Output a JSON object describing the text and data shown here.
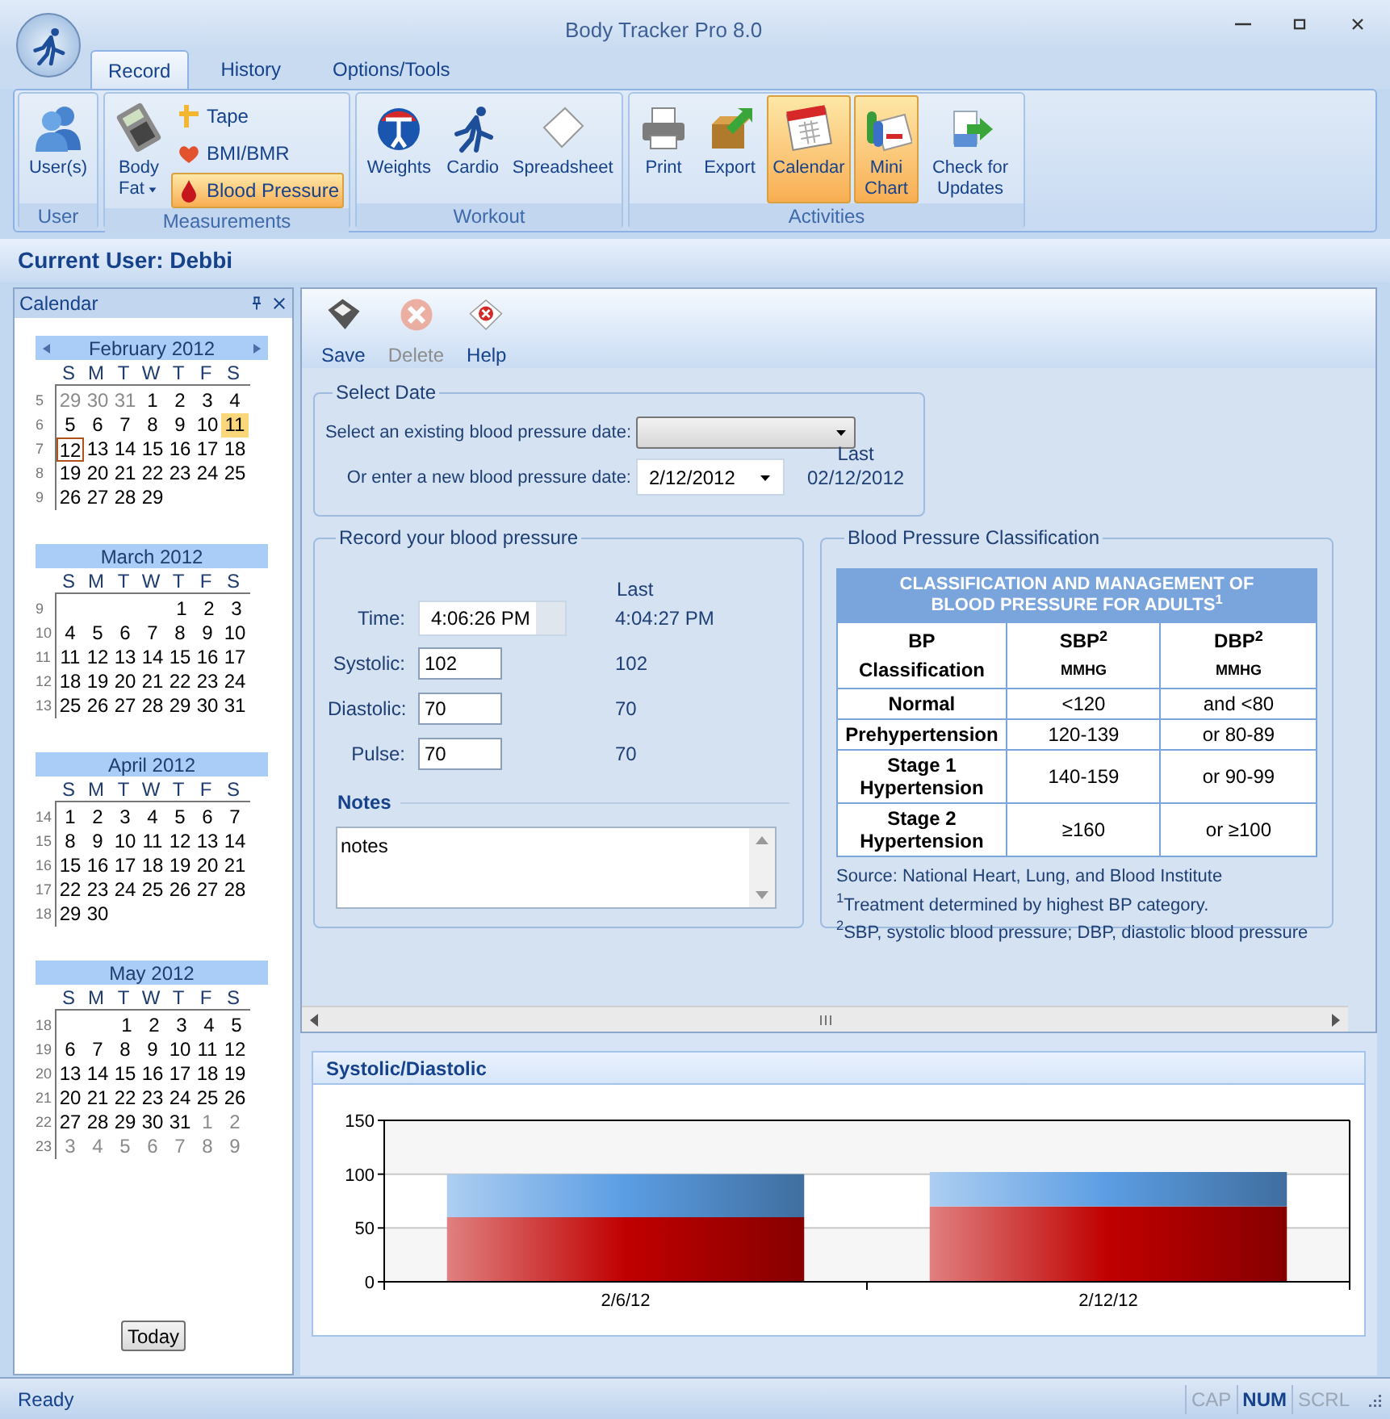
{
  "window": {
    "title": "Body Tracker Pro 8.0"
  },
  "ribbon_tabs": [
    {
      "label": "Record",
      "selected": true
    },
    {
      "label": "History",
      "selected": false
    },
    {
      "label": "Options/Tools",
      "selected": false
    }
  ],
  "ribbon_groups": [
    {
      "label": "User",
      "items": [
        {
          "label": "User(s)",
          "kind": "large",
          "selected": false
        }
      ]
    },
    {
      "label": "Measurements",
      "items": [
        {
          "label": "Body Fat",
          "kind": "dropdown",
          "selected": false
        },
        {
          "label": "Tape",
          "kind": "small",
          "selected": false
        },
        {
          "label": "BMI/BMR",
          "kind": "small",
          "selected": false
        },
        {
          "label": "Blood Pressure",
          "kind": "small",
          "selected": true
        }
      ]
    },
    {
      "label": "Workout",
      "items": [
        {
          "label": "Weights",
          "kind": "large",
          "selected": false
        },
        {
          "label": "Cardio",
          "kind": "large",
          "selected": false
        },
        {
          "label": "Spreadsheet",
          "kind": "large",
          "selected": false
        }
      ]
    },
    {
      "label": "Activities",
      "items": [
        {
          "label": "Print",
          "kind": "large",
          "selected": false
        },
        {
          "label": "Export",
          "kind": "large",
          "selected": false
        },
        {
          "label": "Calendar",
          "kind": "large",
          "selected": true
        },
        {
          "label": "Mini Chart",
          "kind": "large",
          "selected": true
        },
        {
          "label": "Check for Updates",
          "kind": "large",
          "selected": false
        }
      ]
    }
  ],
  "current_user": "Current User: Debbi",
  "calendar": {
    "title": "Calendar",
    "today_button": "Today",
    "months": [
      {
        "title": "February 2012",
        "nav_arrows": true,
        "weekdays": [
          "S",
          "M",
          "T",
          "W",
          "T",
          "F",
          "S"
        ],
        "weeks": [
          {
            "week": "5",
            "days": [
              {
                "day": "29",
                "other_month": true,
                "selected": false,
                "today": false
              },
              {
                "day": "30",
                "other_month": true,
                "selected": false,
                "today": false
              },
              {
                "day": "31",
                "other_month": true,
                "selected": false,
                "today": false
              },
              {
                "day": "1",
                "other_month": false,
                "selected": false,
                "today": false
              },
              {
                "day": "2",
                "other_month": false,
                "selected": false,
                "today": false
              },
              {
                "day": "3",
                "other_month": false,
                "selected": false,
                "today": false
              },
              {
                "day": "4",
                "other_month": false,
                "selected": false,
                "today": false
              }
            ]
          },
          {
            "week": "6",
            "days": [
              {
                "day": "5",
                "other_month": false,
                "selected": false,
                "today": false
              },
              {
                "day": "6",
                "other_month": false,
                "selected": false,
                "today": false
              },
              {
                "day": "7",
                "other_month": false,
                "selected": false,
                "today": false
              },
              {
                "day": "8",
                "other_month": false,
                "selected": false,
                "today": false
              },
              {
                "day": "9",
                "other_month": false,
                "selected": false,
                "today": false
              },
              {
                "day": "10",
                "other_month": false,
                "selected": false,
                "today": false
              },
              {
                "day": "11",
                "other_month": false,
                "selected": true,
                "today": false
              }
            ]
          },
          {
            "week": "7",
            "days": [
              {
                "day": "12",
                "other_month": false,
                "selected": false,
                "today": true
              },
              {
                "day": "13",
                "other_month": false,
                "selected": false,
                "today": false
              },
              {
                "day": "14",
                "other_month": false,
                "selected": false,
                "today": false
              },
              {
                "day": "15",
                "other_month": false,
                "selected": false,
                "today": false
              },
              {
                "day": "16",
                "other_month": false,
                "selected": false,
                "today": false
              },
              {
                "day": "17",
                "other_month": false,
                "selected": false,
                "today": false
              },
              {
                "day": "18",
                "other_month": false,
                "selected": false,
                "today": false
              }
            ]
          },
          {
            "week": "8",
            "days": [
              {
                "day": "19",
                "other_month": false,
                "selected": false,
                "today": false
              },
              {
                "day": "20",
                "other_month": false,
                "selected": false,
                "today": false
              },
              {
                "day": "21",
                "other_month": false,
                "selected": false,
                "today": false
              },
              {
                "day": "22",
                "other_month": false,
                "selected": false,
                "today": false
              },
              {
                "day": "23",
                "other_month": false,
                "selected": false,
                "today": false
              },
              {
                "day": "24",
                "other_month": false,
                "selected": false,
                "today": false
              },
              {
                "day": "25",
                "other_month": false,
                "selected": false,
                "today": false
              }
            ]
          },
          {
            "week": "9",
            "days": [
              {
                "day": "26",
                "other_month": false,
                "selected": false,
                "today": false
              },
              {
                "day": "27",
                "other_month": false,
                "selected": false,
                "today": false
              },
              {
                "day": "28",
                "other_month": false,
                "selected": false,
                "today": false
              },
              {
                "day": "29",
                "other_month": false,
                "selected": false,
                "today": false
              }
            ]
          }
        ]
      },
      {
        "title": "March 2012",
        "nav_arrows": false,
        "weekdays": [
          "S",
          "M",
          "T",
          "W",
          "T",
          "F",
          "S"
        ],
        "weeks": [
          {
            "week": "9",
            "align_end": true,
            "days": [
              {
                "day": "1",
                "other_month": false,
                "selected": false,
                "today": false
              },
              {
                "day": "2",
                "other_month": false,
                "selected": false,
                "today": false
              },
              {
                "day": "3",
                "other_month": false,
                "selected": false,
                "today": false
              }
            ]
          },
          {
            "week": "10",
            "days": [
              {
                "day": "4",
                "other_month": false,
                "selected": false,
                "today": false
              },
              {
                "day": "5",
                "other_month": false,
                "selected": false,
                "today": false
              },
              {
                "day": "6",
                "other_month": false,
                "selected": false,
                "today": false
              },
              {
                "day": "7",
                "other_month": false,
                "selected": false,
                "today": false
              },
              {
                "day": "8",
                "other_month": false,
                "selected": false,
                "today": false
              },
              {
                "day": "9",
                "other_month": false,
                "selected": false,
                "today": false
              },
              {
                "day": "10",
                "other_month": false,
                "selected": false,
                "today": false
              }
            ]
          },
          {
            "week": "11",
            "days": [
              {
                "day": "11",
                "other_month": false,
                "selected": false,
                "today": false
              },
              {
                "day": "12",
                "other_month": false,
                "selected": false,
                "today": false
              },
              {
                "day": "13",
                "other_month": false,
                "selected": false,
                "today": false
              },
              {
                "day": "14",
                "other_month": false,
                "selected": false,
                "today": false
              },
              {
                "day": "15",
                "other_month": false,
                "selected": false,
                "today": false
              },
              {
                "day": "16",
                "other_month": false,
                "selected": false,
                "today": false
              },
              {
                "day": "17",
                "other_month": false,
                "selected": false,
                "today": false
              }
            ]
          },
          {
            "week": "12",
            "days": [
              {
                "day": "18",
                "other_month": false,
                "selected": false,
                "today": false
              },
              {
                "day": "19",
                "other_month": false,
                "selected": false,
                "today": false
              },
              {
                "day": "20",
                "other_month": false,
                "selected": false,
                "today": false
              },
              {
                "day": "21",
                "other_month": false,
                "selected": false,
                "today": false
              },
              {
                "day": "22",
                "other_month": false,
                "selected": false,
                "today": false
              },
              {
                "day": "23",
                "other_month": false,
                "selected": false,
                "today": false
              },
              {
                "day": "24",
                "other_month": false,
                "selected": false,
                "today": false
              }
            ]
          },
          {
            "week": "13",
            "days": [
              {
                "day": "25",
                "other_month": false,
                "selected": false,
                "today": false
              },
              {
                "day": "26",
                "other_month": false,
                "selected": false,
                "today": false
              },
              {
                "day": "27",
                "other_month": false,
                "selected": false,
                "today": false
              },
              {
                "day": "28",
                "other_month": false,
                "selected": false,
                "today": false
              },
              {
                "day": "29",
                "other_month": false,
                "selected": false,
                "today": false
              },
              {
                "day": "30",
                "other_month": false,
                "selected": false,
                "today": false
              },
              {
                "day": "31",
                "other_month": false,
                "selected": false,
                "today": false
              }
            ]
          }
        ]
      },
      {
        "title": "April 2012",
        "nav_arrows": false,
        "weekdays": [
          "S",
          "M",
          "T",
          "W",
          "T",
          "F",
          "S"
        ],
        "weeks": [
          {
            "week": "14",
            "days": [
              {
                "day": "1",
                "other_month": false,
                "selected": false,
                "today": false
              },
              {
                "day": "2",
                "other_month": false,
                "selected": false,
                "today": false
              },
              {
                "day": "3",
                "other_month": false,
                "selected": false,
                "today": false
              },
              {
                "day": "4",
                "other_month": false,
                "selected": false,
                "today": false
              },
              {
                "day": "5",
                "other_month": false,
                "selected": false,
                "today": false
              },
              {
                "day": "6",
                "other_month": false,
                "selected": false,
                "today": false
              },
              {
                "day": "7",
                "other_month": false,
                "selected": false,
                "today": false
              }
            ]
          },
          {
            "week": "15",
            "days": [
              {
                "day": "8",
                "other_month": false,
                "selected": false,
                "today": false
              },
              {
                "day": "9",
                "other_month": false,
                "selected": false,
                "today": false
              },
              {
                "day": "10",
                "other_month": false,
                "selected": false,
                "today": false
              },
              {
                "day": "11",
                "other_month": false,
                "selected": false,
                "today": false
              },
              {
                "day": "12",
                "other_month": false,
                "selected": false,
                "today": false
              },
              {
                "day": "13",
                "other_month": false,
                "selected": false,
                "today": false
              },
              {
                "day": "14",
                "other_month": false,
                "selected": false,
                "today": false
              }
            ]
          },
          {
            "week": "16",
            "days": [
              {
                "day": "15",
                "other_month": false,
                "selected": false,
                "today": false
              },
              {
                "day": "16",
                "other_month": false,
                "selected": false,
                "today": false
              },
              {
                "day": "17",
                "other_month": false,
                "selected": false,
                "today": false
              },
              {
                "day": "18",
                "other_month": false,
                "selected": false,
                "today": false
              },
              {
                "day": "19",
                "other_month": false,
                "selected": false,
                "today": false
              },
              {
                "day": "20",
                "other_month": false,
                "selected": false,
                "today": false
              },
              {
                "day": "21",
                "other_month": false,
                "selected": false,
                "today": false
              }
            ]
          },
          {
            "week": "17",
            "days": [
              {
                "day": "22",
                "other_month": false,
                "selected": false,
                "today": false
              },
              {
                "day": "23",
                "other_month": false,
                "selected": false,
                "today": false
              },
              {
                "day": "24",
                "other_month": false,
                "selected": false,
                "today": false
              },
              {
                "day": "25",
                "other_month": false,
                "selected": false,
                "today": false
              },
              {
                "day": "26",
                "other_month": false,
                "selected": false,
                "today": false
              },
              {
                "day": "27",
                "other_month": false,
                "selected": false,
                "today": false
              },
              {
                "day": "28",
                "other_month": false,
                "selected": false,
                "today": false
              }
            ]
          },
          {
            "week": "18",
            "days": [
              {
                "day": "29",
                "other_month": false,
                "selected": false,
                "today": false
              },
              {
                "day": "30",
                "other_month": false,
                "selected": false,
                "today": false
              }
            ]
          }
        ]
      },
      {
        "title": "May 2012",
        "nav_arrows": false,
        "weekdays": [
          "S",
          "M",
          "T",
          "W",
          "T",
          "F",
          "S"
        ],
        "weeks": [
          {
            "week": "18",
            "align_end": true,
            "days": [
              {
                "day": "1",
                "other_month": false,
                "selected": false,
                "today": false
              },
              {
                "day": "2",
                "other_month": false,
                "selected": false,
                "today": false
              },
              {
                "day": "3",
                "other_month": false,
                "selected": false,
                "today": false
              },
              {
                "day": "4",
                "other_month": false,
                "selected": false,
                "today": false
              },
              {
                "day": "5",
                "other_month": false,
                "selected": false,
                "today": false
              }
            ]
          },
          {
            "week": "19",
            "days": [
              {
                "day": "6",
                "other_month": false,
                "selected": false,
                "today": false
              },
              {
                "day": "7",
                "other_month": false,
                "selected": false,
                "today": false
              },
              {
                "day": "8",
                "other_month": false,
                "selected": false,
                "today": false
              },
              {
                "day": "9",
                "other_month": false,
                "selected": false,
                "today": false
              },
              {
                "day": "10",
                "other_month": false,
                "selected": false,
                "today": false
              },
              {
                "day": "11",
                "other_month": false,
                "selected": false,
                "today": false
              },
              {
                "day": "12",
                "other_month": false,
                "selected": false,
                "today": false
              }
            ]
          },
          {
            "week": "20",
            "days": [
              {
                "day": "13",
                "other_month": false,
                "selected": false,
                "today": false
              },
              {
                "day": "14",
                "other_month": false,
                "selected": false,
                "today": false
              },
              {
                "day": "15",
                "other_month": false,
                "selected": false,
                "today": false
              },
              {
                "day": "16",
                "other_month": false,
                "selected": false,
                "today": false
              },
              {
                "day": "17",
                "other_month": false,
                "selected": false,
                "today": false
              },
              {
                "day": "18",
                "other_month": false,
                "selected": false,
                "today": false
              },
              {
                "day": "19",
                "other_month": false,
                "selected": false,
                "today": false
              }
            ]
          },
          {
            "week": "21",
            "days": [
              {
                "day": "20",
                "other_month": false,
                "selected": false,
                "today": false
              },
              {
                "day": "21",
                "other_month": false,
                "selected": false,
                "today": false
              },
              {
                "day": "22",
                "other_month": false,
                "selected": false,
                "today": false
              },
              {
                "day": "23",
                "other_month": false,
                "selected": false,
                "today": false
              },
              {
                "day": "24",
                "other_month": false,
                "selected": false,
                "today": false
              },
              {
                "day": "25",
                "other_month": false,
                "selected": false,
                "today": false
              },
              {
                "day": "26",
                "other_month": false,
                "selected": false,
                "today": false
              }
            ]
          },
          {
            "week": "22",
            "days": [
              {
                "day": "27",
                "other_month": false,
                "selected": false,
                "today": false
              },
              {
                "day": "28",
                "other_month": false,
                "selected": false,
                "today": false
              },
              {
                "day": "29",
                "other_month": false,
                "selected": false,
                "today": false
              },
              {
                "day": "30",
                "other_month": false,
                "selected": false,
                "today": false
              },
              {
                "day": "31",
                "other_month": false,
                "selected": false,
                "today": false
              },
              {
                "day": "1",
                "other_month": true,
                "selected": false,
                "today": false
              },
              {
                "day": "2",
                "other_month": true,
                "selected": false,
                "today": false
              }
            ]
          },
          {
            "week": "23",
            "days": [
              {
                "day": "3",
                "other_month": true,
                "selected": false,
                "today": false
              },
              {
                "day": "4",
                "other_month": true,
                "selected": false,
                "today": false
              },
              {
                "day": "5",
                "other_month": true,
                "selected": false,
                "today": false
              },
              {
                "day": "6",
                "other_month": true,
                "selected": false,
                "today": false
              },
              {
                "day": "7",
                "other_month": true,
                "selected": false,
                "today": false
              },
              {
                "day": "8",
                "other_month": true,
                "selected": false,
                "today": false
              },
              {
                "day": "9",
                "other_month": true,
                "selected": false,
                "today": false
              }
            ]
          }
        ]
      }
    ]
  },
  "toolbar": [
    {
      "label": "Save",
      "disabled": false
    },
    {
      "label": "Delete",
      "disabled": true
    },
    {
      "label": "Help",
      "disabled": false
    }
  ],
  "select_date": {
    "title": "Select Date",
    "existing_label": "Select an existing blood pressure date:",
    "new_label": "Or enter a new blood pressure date:",
    "new_value": "2/12/2012",
    "last_label": "Last",
    "last_value": "02/12/2012"
  },
  "record": {
    "title": "Record your blood pressure",
    "last_label": "Last",
    "fields": [
      {
        "label": "Time:",
        "value": "4:06:26 PM",
        "last": "4:04:27 PM",
        "kind": "time"
      },
      {
        "label": "Systolic:",
        "value": "102",
        "last": "102",
        "kind": "number"
      },
      {
        "label": "Diastolic:",
        "value": "70",
        "last": "70",
        "kind": "number"
      },
      {
        "label": "Pulse:",
        "value": "70",
        "last": "70",
        "kind": "number"
      }
    ],
    "notes_title": "Notes",
    "notes": "notes"
  },
  "classification": {
    "title": "Blood Pressure Classification",
    "table_title": "CLASSIFICATION AND MANAGEMENT OF BLOOD PRESSURE FOR ADULTS$^{1}$",
    "columns": [
      {
        "heading": "BP",
        "subheading": "Classification"
      },
      {
        "heading": "SBP$^{2}$",
        "subheading": "MMHG"
      },
      {
        "heading": "DBP$^{2}$",
        "subheading": "MMHG"
      }
    ],
    "rows": [
      [
        "Normal",
        "<120",
        "and <80"
      ],
      [
        "Prehypertension",
        "120-139",
        "or 80-89"
      ],
      [
        "Stage 1 Hypertension",
        "140-159",
        "or 90-99"
      ],
      [
        "Stage 2 Hypertension",
        "≥160",
        "or ≥100"
      ]
    ],
    "source": "Source: National Heart, Lung, and Blood Institute",
    "footnotes": [
      "$^{1}$Treatment determined by highest BP category.",
      "$^{2}$SBP, systolic blood pressure; DBP, diastolic blood pressure"
    ]
  },
  "chart": {
    "chart_data": {
      "type": "bar",
      "title": "Systolic/Diastolic",
      "categories": [
        "2/6/12",
        "2/12/12"
      ],
      "series": [
        {
          "color": "#c00000",
          "values": [
            60,
            70
          ]
        },
        {
          "color": "#5b9de3",
          "values": [
            40,
            32
          ]
        }
      ],
      "stacked": true,
      "ylim": [
        0,
        150
      ],
      "yticks": [
        0,
        50,
        100,
        150
      ]
    }
  },
  "status_bar": {
    "text": "Ready",
    "indicators": [
      {
        "label": "CAP",
        "on": false
      },
      {
        "label": "NUM",
        "on": true
      },
      {
        "label": "SCRL",
        "on": false
      }
    ]
  }
}
